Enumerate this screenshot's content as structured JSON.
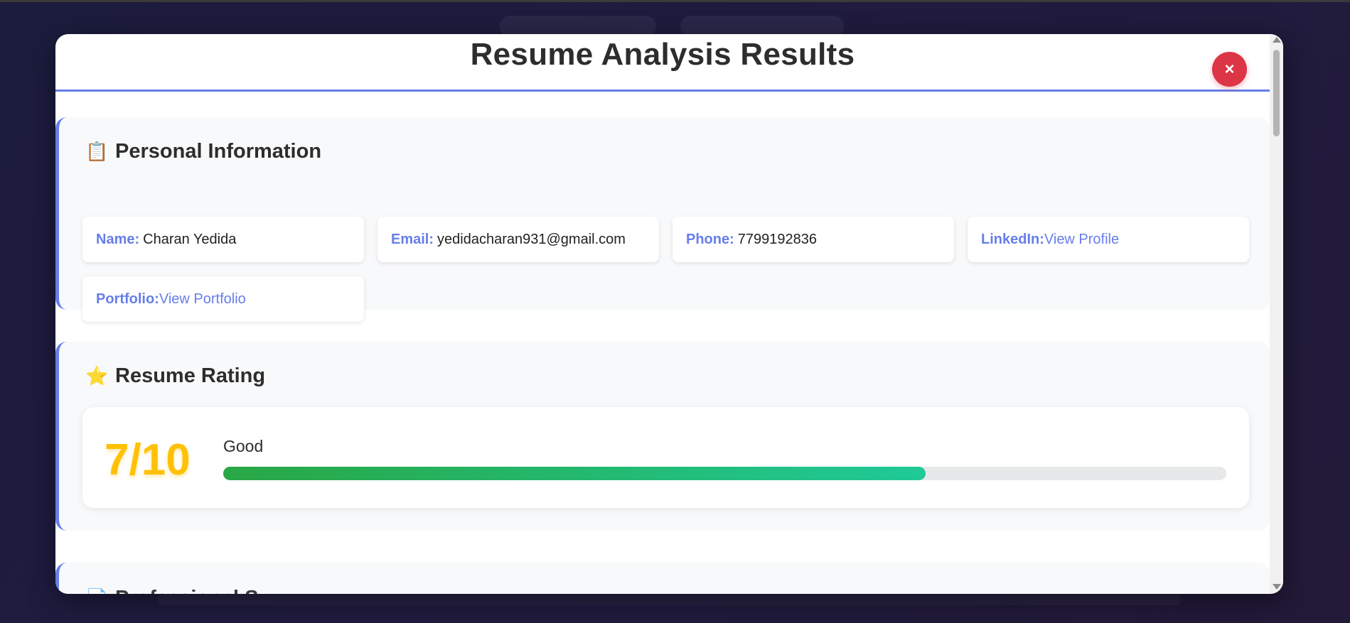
{
  "modal": {
    "title": "Resume Analysis Results",
    "close_label": "×"
  },
  "personal": {
    "icon": "📋",
    "heading": "Personal Information",
    "name_label": "Name:",
    "name_value": "Charan Yedida",
    "email_label": "Email:",
    "email_value": "yedidacharan931@gmail.com",
    "phone_label": "Phone:",
    "phone_value": "7799192836",
    "linkedin_label": "LinkedIn:",
    "linkedin_link": "View Profile",
    "portfolio_label": "Portfolio:",
    "portfolio_link": "View Portfolio"
  },
  "rating": {
    "icon": "⭐",
    "heading": "Resume Rating",
    "score_text": "7/10",
    "label": "Good",
    "progress_fraction": 0.7
  },
  "summary": {
    "icon": "📄",
    "heading": "Professional S"
  },
  "colors": {
    "accent": "#667eea",
    "close": "#dc3545",
    "score": "#ffc107",
    "progress_start": "#28a745",
    "progress_end": "#20c997"
  }
}
